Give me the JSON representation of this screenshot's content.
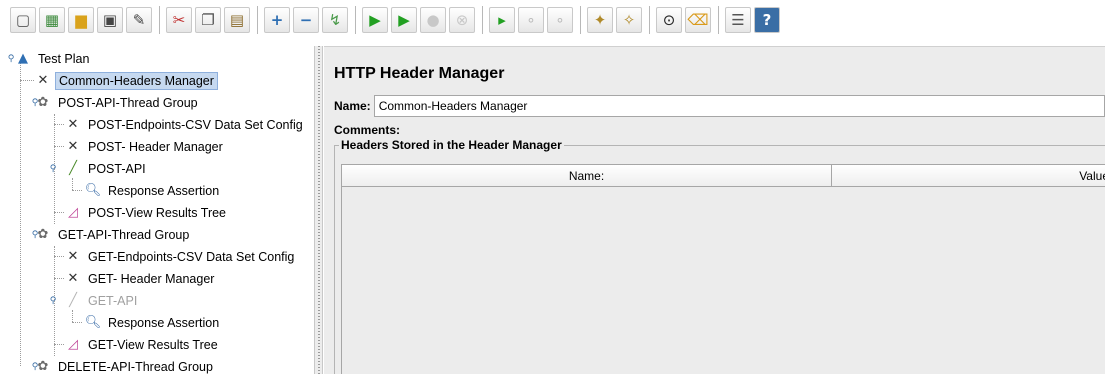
{
  "toolbar": {
    "buttons": [
      {
        "icon": "new-icon",
        "glyph": "▢"
      },
      {
        "icon": "templates-icon",
        "glyph": "▦"
      },
      {
        "icon": "open-icon",
        "glyph": "▆"
      },
      {
        "icon": "save-icon",
        "glyph": "▣"
      },
      {
        "icon": "save-as-icon",
        "glyph": "✎"
      },
      {
        "icon": "cut-icon",
        "glyph": "✂"
      },
      {
        "icon": "copy-icon",
        "glyph": "❐"
      },
      {
        "icon": "paste-icon",
        "glyph": "▤"
      },
      {
        "icon": "expand-icon",
        "glyph": "+"
      },
      {
        "icon": "collapse-icon",
        "glyph": "−"
      },
      {
        "icon": "toggle-icon",
        "glyph": "↯"
      },
      {
        "icon": "start-icon",
        "glyph": "▶"
      },
      {
        "icon": "start-no-pauses-icon",
        "glyph": "▶"
      },
      {
        "icon": "stop-icon",
        "glyph": "●"
      },
      {
        "icon": "shutdown-icon",
        "glyph": "⊗"
      },
      {
        "icon": "remote-start-icon",
        "glyph": "▸"
      },
      {
        "icon": "remote-stop-icon",
        "glyph": "∘"
      },
      {
        "icon": "remote-shutdown-icon",
        "glyph": "∘"
      },
      {
        "icon": "clear-icon",
        "glyph": "✦"
      },
      {
        "icon": "clear-all-icon",
        "glyph": "✧"
      },
      {
        "icon": "search-icon",
        "glyph": "⊙"
      },
      {
        "icon": "reset-search-icon",
        "glyph": "⌫"
      },
      {
        "icon": "function-helper-icon",
        "glyph": "☰"
      },
      {
        "icon": "help-icon",
        "glyph": "?"
      }
    ]
  },
  "tree": {
    "nodes": [
      {
        "label": "Test Plan",
        "icon": "test-plan-icon",
        "glyph": "▲",
        "color": "#2f6fb3"
      },
      {
        "label": "Common-Headers Manager",
        "icon": "config-wrench-icon",
        "glyph": "✕",
        "color": "#333333"
      },
      {
        "label": "POST-API-Thread Group",
        "icon": "thread-group-icon",
        "glyph": "✿",
        "color": "#6b6b6b"
      },
      {
        "label": "POST-Endpoints-CSV Data Set Config",
        "icon": "config-wrench-icon",
        "glyph": "✕",
        "color": "#333333"
      },
      {
        "label": "POST- Header Manager",
        "icon": "config-wrench-icon",
        "glyph": "✕",
        "color": "#333333"
      },
      {
        "label": "POST-API",
        "icon": "sampler-pipette-icon",
        "glyph": "╱",
        "color": "#4a8a2a"
      },
      {
        "label": "Response Assertion",
        "icon": "assertion-magnifier-icon",
        "glyph": "🔍︎",
        "color": "#3d6ea8"
      },
      {
        "label": "POST-View Results Tree",
        "icon": "listener-graph-icon",
        "glyph": "◿",
        "color": "#c04a9a"
      },
      {
        "label": "GET-API-Thread Group",
        "icon": "thread-group-icon",
        "glyph": "✿",
        "color": "#6b6b6b"
      },
      {
        "label": "GET-Endpoints-CSV Data Set Config",
        "icon": "config-wrench-icon",
        "glyph": "✕",
        "color": "#333333"
      },
      {
        "label": "GET- Header Manager",
        "icon": "config-wrench-icon",
        "glyph": "✕",
        "color": "#333333"
      },
      {
        "label": "GET-API",
        "icon": "sampler-pipette-icon",
        "glyph": "╱",
        "color": "#b5b5b5"
      },
      {
        "label": "Response Assertion",
        "icon": "assertion-magnifier-icon",
        "glyph": "🔍︎",
        "color": "#3d6ea8"
      },
      {
        "label": "GET-View Results Tree",
        "icon": "listener-graph-icon",
        "glyph": "◿",
        "color": "#c04a9a"
      },
      {
        "label": "DELETE-API-Thread Group",
        "icon": "thread-group-icon",
        "glyph": "✿",
        "color": "#6b6b6b"
      }
    ],
    "selected": "Common-Headers Manager",
    "disabled": [
      "GET-API"
    ]
  },
  "panel": {
    "title": "HTTP Header Manager",
    "name_label": "Name:",
    "name_value": "Common-Headers Manager",
    "comments_label": "Comments:",
    "headers_group_label": "Headers Stored in the Header Manager",
    "table": {
      "columns": [
        "Name:",
        "Value"
      ],
      "rows": []
    }
  },
  "colors": {
    "selection": "#c6d9f0",
    "panel_background": "#ececec",
    "disabled_text": "#a0a0a0"
  }
}
